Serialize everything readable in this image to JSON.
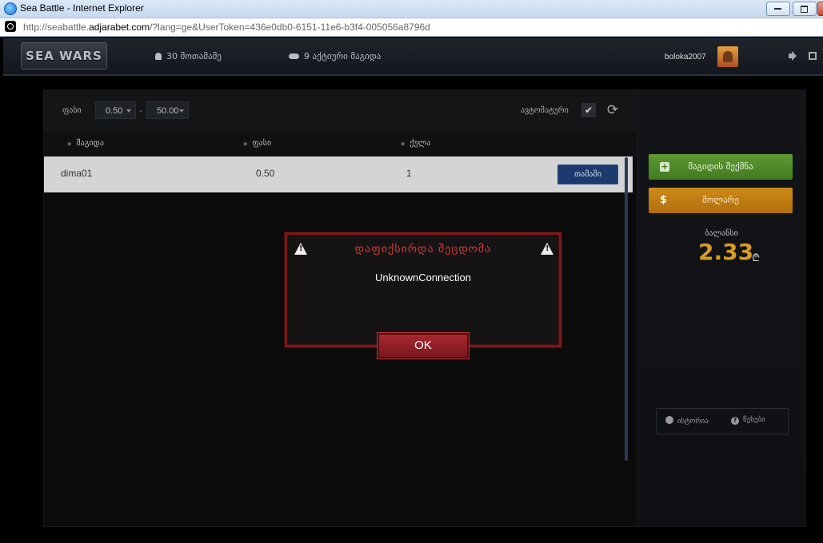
{
  "window": {
    "title": "Sea Battle - Internet Explorer",
    "url_prefix": "http://seabattle.",
    "url_domain": "adjarabet.com",
    "url_rest": "/?lang=ge&UserToken=436e0db0-6151-11e6-b3f4-005056a8796d"
  },
  "header": {
    "logo_text": "SEA WARS",
    "players_count": "30 მოთამაშე",
    "active_games": "9 აქტიური მაგიდა",
    "username": "boloka2007"
  },
  "filters": {
    "price_label": "ფასი",
    "min_value": "0.50",
    "dash": "-",
    "max_value": "50.00",
    "auto_label": "ავტომატური",
    "check_glyph": "✔",
    "refresh_glyph": "⟳"
  },
  "table": {
    "sort_glyph": "◆",
    "headers": [
      "მაგიდა",
      "ფასი",
      "ქულა"
    ],
    "rows": [
      {
        "table": "dima01",
        "price": "0.50",
        "score": "1",
        "action": "თამაში"
      }
    ]
  },
  "sidebar": {
    "create_table": "მაგიდის შექმნა",
    "plus_glyph": "+",
    "cashout": "მოლარე",
    "dollar_glyph": "$",
    "balance_label": "ბალანსი",
    "balance_value": "2.33",
    "currency": "₾",
    "history": "ისტორია",
    "rules": "წესები",
    "question_glyph": "?"
  },
  "modal": {
    "title": "დაფიქსირდა შეცდომა",
    "message": "UnknownConnection",
    "ok_label": "OK"
  },
  "colors": {
    "error_red": "#d23a3a",
    "create_green": "#5e9a32",
    "cashout_orange": "#cf8a18",
    "balance_gold": "#d79b22",
    "play_blue": "#1d3a6e"
  }
}
